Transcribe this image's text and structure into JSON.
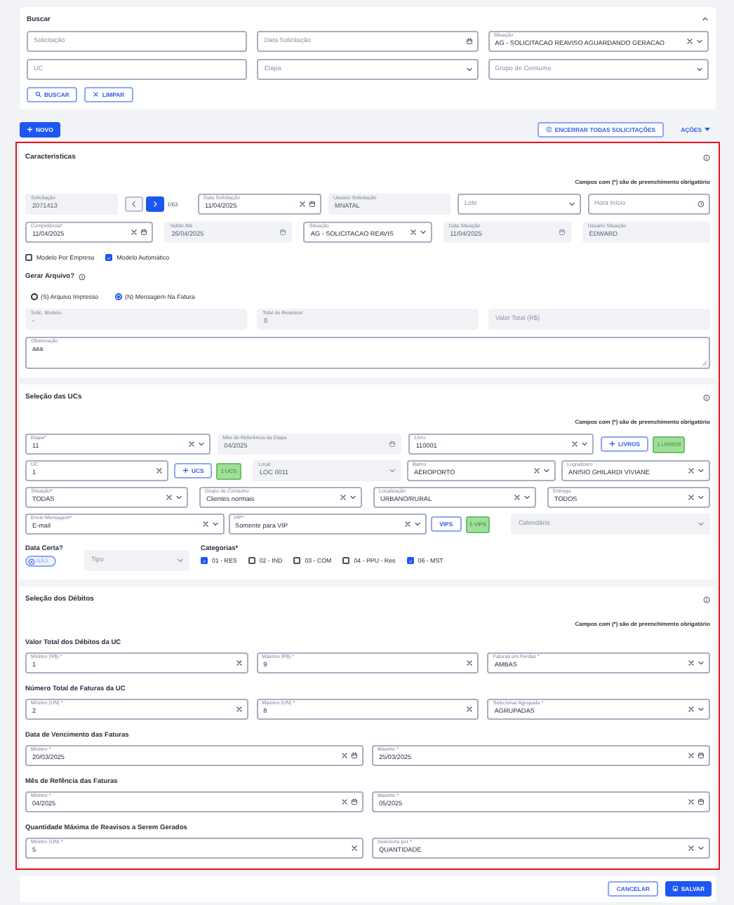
{
  "search": {
    "title": "Buscar",
    "expanded": true,
    "fields": [
      {
        "kind": "text",
        "placeholder": "Solicitação",
        "disabled": false
      },
      {
        "kind": "date",
        "placeholder": "Data Solicitação",
        "disabled": false
      },
      {
        "kind": "select",
        "label": "Situação",
        "value": "AG - SOLICITACAO REAVISO AGUARDANDO GERACAO",
        "clearable": true,
        "disabled": false
      },
      {
        "kind": "text",
        "placeholder": "UC",
        "disabled": false
      },
      {
        "kind": "select",
        "placeholder": "Etapa",
        "disabled": false
      },
      {
        "kind": "select",
        "placeholder": "Grupo de Consumo",
        "disabled": false
      }
    ],
    "buttons": [
      "BUSCAR",
      "LIMPAR"
    ]
  },
  "toolbar": {
    "new_button": "NOVO",
    "close_all_button": "ENCERRAR TODAS SOLICITAÇÕES",
    "actions_menu": "AÇÕES"
  },
  "characteristics": {
    "title": "Caracteristicas",
    "required_note": "Campos com (*) são de preenchimento obrigatório",
    "row_1": [
      {
        "kind": "text",
        "label": "Solicitação",
        "value": "2071413",
        "disabled": true
      },
      {
        "kind": "date",
        "label": "Data Solicitação",
        "value": "11/04/2025",
        "clearable": true,
        "disabled": false
      },
      {
        "kind": "text",
        "label": "Usuário Solicitação",
        "value": "MNATAL",
        "disabled": true
      },
      {
        "kind": "select",
        "placeholder": "Lote",
        "disabled": false
      },
      {
        "kind": "time",
        "placeholder": "Hora Início",
        "disabled": false
      }
    ],
    "pager": {
      "counter": "1/63",
      "prev": {
        "disabled": true
      },
      "next": {
        "disabled": false
      }
    },
    "row_2": [
      {
        "kind": "date",
        "label": "Competência*",
        "value": "11/04/2025",
        "clearable": true,
        "disabled": false
      },
      {
        "kind": "date",
        "label": "Valido Até",
        "value": "26/04/2025",
        "disabled": true
      },
      {
        "kind": "select",
        "label": "Situação",
        "value": "AG - SOLICITACAO REAVIS",
        "clearable": true,
        "disabled": false
      },
      {
        "kind": "date",
        "label": "Data Situação",
        "value": "11/04/2025",
        "disabled": true
      },
      {
        "kind": "text",
        "label": "Usuário Situação",
        "value": "EDWARD",
        "disabled": true
      }
    ],
    "checkboxes": [
      {
        "label": "Modelo Por Empresa",
        "checked": false
      },
      {
        "label": "Modelo Automático",
        "checked": true
      }
    ],
    "file_question": "Gerar Arquivo?",
    "radios": [
      {
        "label": "(S) Arquivo Impresso",
        "selected": false
      },
      {
        "label": "(N) Mensagem Na Fatura",
        "selected": true
      }
    ],
    "row_3": [
      {
        "kind": "text",
        "label": "Solic. Modelo",
        "value": "-",
        "disabled": true
      },
      {
        "kind": "text",
        "label": "Total de Reavisos",
        "value": "0",
        "disabled": true
      },
      {
        "kind": "text",
        "placeholder": "Valor Total (R$)",
        "disabled": true
      }
    ],
    "notes_field": {
      "kind": "textarea",
      "label": "Observação",
      "value": "aaa",
      "disabled": false
    }
  },
  "ucs": {
    "title": "Seleção das UCs",
    "required_note": "Campos com (*) são de preenchimento obrigatório",
    "row_1": [
      {
        "kind": "select",
        "label": "Etapa*",
        "value": "11",
        "clearable": true,
        "disabled": false
      },
      {
        "kind": "date",
        "label": "Mês de Referência da Etapa",
        "value": "04/2025",
        "disabled": true
      },
      {
        "kind": "select",
        "label": "Livro",
        "value": "110001",
        "clearable": true,
        "disabled": false
      }
    ],
    "books_button": "LIVROS",
    "books_badge": "1 LIVROS",
    "uc_field": {
      "kind": "text",
      "label": "UC",
      "value": "1",
      "clearable": true,
      "disabled": false
    },
    "ucs_button": "UCS",
    "ucs_badge": "1 UCS",
    "row_2": [
      {
        "kind": "select",
        "label": "Local",
        "value": "LOC 0011",
        "disabled": true
      },
      {
        "kind": "select",
        "label": "Bairro",
        "value": "AEROPORTO",
        "clearable": true,
        "disabled": false
      },
      {
        "kind": "select",
        "label": "Logradouro",
        "value": "ANISIO GHILARDI VIVIANE",
        "clearable": true,
        "disabled": false
      }
    ],
    "row_3": [
      {
        "kind": "select",
        "label": "Situação*",
        "value": "TODAS",
        "clearable": true,
        "disabled": false
      },
      {
        "kind": "select",
        "label": "Grupo de Consumo",
        "value": "Clientes normais",
        "clearable": true,
        "disabled": false
      },
      {
        "kind": "select",
        "label": "Localização",
        "value": "URBANO/RURAL",
        "clearable": true,
        "disabled": false
      },
      {
        "kind": "select",
        "label": "Entrega",
        "value": "TODOS",
        "clearable": true,
        "disabled": false
      }
    ],
    "row_4": [
      {
        "kind": "select",
        "label": "Envio Mensagem*",
        "value": "E-mail",
        "clearable": true,
        "disabled": false
      },
      {
        "kind": "select",
        "label": "VIP*",
        "value": "Somente para VIP",
        "clearable": true,
        "disabled": false
      }
    ],
    "vips_button": "VIPS",
    "vips_badge": "5 VIPS",
    "calendar_field": {
      "kind": "select",
      "placeholder": "Calendário",
      "disabled": true
    },
    "exact_date": {
      "label": "Data Certa?",
      "toggle_label": "NÃO",
      "on": false
    },
    "type_field": {
      "kind": "select",
      "placeholder": "Tipo",
      "disabled": true
    },
    "categories": {
      "label": "Categorias*",
      "items": [
        {
          "label": "01 - RES",
          "checked": true
        },
        {
          "label": "02 - IND",
          "checked": false
        },
        {
          "label": "03 - COM",
          "checked": false
        },
        {
          "label": "04 - PPU - Res",
          "checked": false
        },
        {
          "label": "06 - MST",
          "checked": true
        }
      ]
    }
  },
  "debits": {
    "title": "Seleção dos Débitos",
    "required_note": "Campos com (*) são de preenchimento obrigatório",
    "groups": [
      {
        "title": "Valor Total dos Débitos da UC",
        "fields": [
          {
            "kind": "text",
            "label": "Mínimo (R$) *",
            "value": "1",
            "clearable": true,
            "disabled": false
          },
          {
            "kind": "text",
            "label": "Máximo (R$) *",
            "value": "9",
            "clearable": true,
            "disabled": false
          },
          {
            "kind": "select",
            "label": "Faturas em Perdas *",
            "value": "AMBAS",
            "clearable": true,
            "disabled": false
          }
        ]
      },
      {
        "title": "Número Total de Faturas da UC",
        "fields": [
          {
            "kind": "text",
            "label": "Mínimo (UN) *",
            "value": "2",
            "clearable": true,
            "disabled": false
          },
          {
            "kind": "text",
            "label": "Máximo (UN) *",
            "value": "8",
            "clearable": true,
            "disabled": false
          },
          {
            "kind": "select",
            "label": "Selecionar Agrupada *",
            "value": "AGRUPADAS",
            "clearable": true,
            "disabled": false
          }
        ]
      },
      {
        "title": "Data de Vencimento das Faturas",
        "fields": [
          {
            "kind": "date",
            "label": "Mínimo *",
            "value": "20/03/2025",
            "clearable": true,
            "disabled": false
          },
          {
            "kind": "date",
            "label": "Máximo *",
            "value": "25/03/2025",
            "clearable": true,
            "disabled": false
          }
        ]
      },
      {
        "title": "Mês de Refência das Faturas",
        "fields": [
          {
            "kind": "date",
            "label": "Mínimo *",
            "value": "04/2025",
            "clearable": true,
            "disabled": false
          },
          {
            "kind": "date",
            "label": "Máximo *",
            "value": "05/2025",
            "clearable": true,
            "disabled": false
          }
        ]
      },
      {
        "title": "Quantidade Máxima de Reavisos a Serem Gerados",
        "fields": [
          {
            "kind": "text",
            "label": "Mínimo (UN) *",
            "value": "5",
            "clearable": true,
            "disabled": false
          },
          {
            "kind": "select",
            "label": "Selecione por *",
            "value": "QUANTIDADE",
            "clearable": true,
            "disabled": false
          }
        ]
      }
    ]
  },
  "footer": {
    "buttons": [
      "CANCELAR",
      "SALVAR"
    ]
  }
}
